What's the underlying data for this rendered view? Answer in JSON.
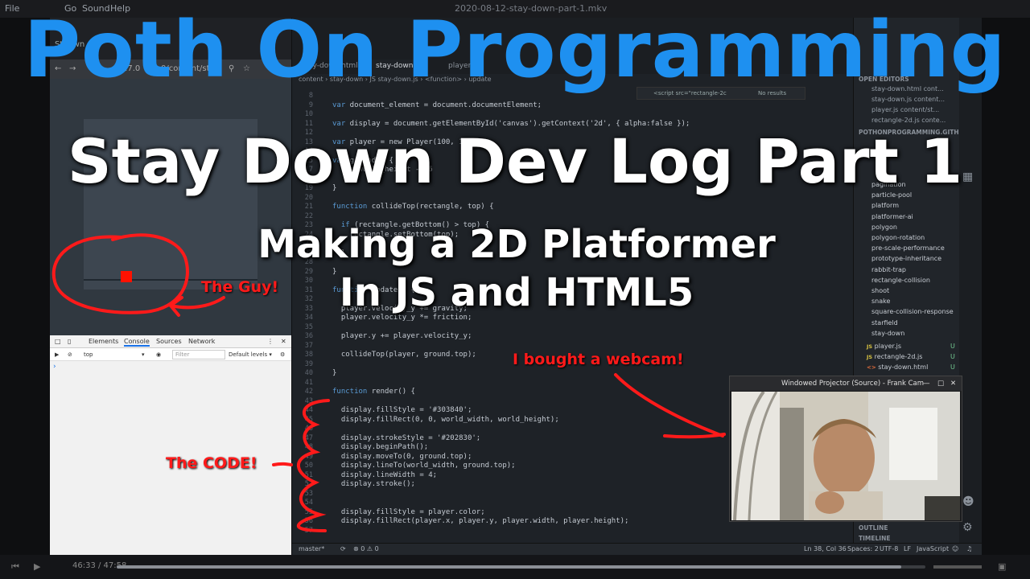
{
  "player": {
    "menu": [
      "File",
      "Go",
      "Sound",
      "Help"
    ],
    "video_title": "2020-08-12-stay-down-part-1.mkv",
    "time": "46:33 / 47:58",
    "progress": 0.97
  },
  "overlay": {
    "title": "Poth On Programming",
    "subtitle": "Stay Down Dev Log Part 1",
    "tagline_1": "Making a 2D Platformer",
    "tagline_2": "In JS and HTML5",
    "annotation_guy": "The Guy!",
    "annotation_code": "The CODE!",
    "annotation_cam": "I bought a webcam!"
  },
  "browser": {
    "tab": "St..own",
    "url_fragment": "27.0",
    "url_path": "0/content/sta...",
    "colors": {
      "world": "#303840",
      "ground": "#202830",
      "player": "#ff1100"
    }
  },
  "devtools": {
    "tabs": [
      "Elements",
      "Console",
      "Sources",
      "Network"
    ],
    "active_tab": "Console",
    "context": "top",
    "filter_placeholder": "Filter",
    "levels": "Default levels ▾"
  },
  "editor": {
    "tabs": [
      "...tay-down.html",
      "stay-down.js",
      "player.js"
    ],
    "breadcrumb": "content › stay-down › JS stay-down.js › <function> › update",
    "find_value": "<script src=\"rectangle-2c",
    "find_result": "No results",
    "lines": [
      {
        "n": "8",
        "t": ""
      },
      {
        "n": "9",
        "t": "var document_element = document.documentElement;"
      },
      {
        "n": "10",
        "t": ""
      },
      {
        "n": "11",
        "t": "var display = document.getElementById('canvas').getContext('2d', { alpha:false });"
      },
      {
        "n": "12",
        "t": ""
      },
      {
        "n": "13",
        "t": "var player = new Player(100, 100);"
      },
      {
        "n": "14",
        "t": ""
      },
      {
        "n": "15",
        "t": "var ground = {"
      },
      {
        "n": "17",
        "t": "  top:world_height - 16"
      },
      {
        "n": "18",
        "t": ""
      },
      {
        "n": "19",
        "t": "}"
      },
      {
        "n": "20",
        "t": ""
      },
      {
        "n": "21",
        "t": "function collideTop(rectangle, top) {"
      },
      {
        "n": "22",
        "t": ""
      },
      {
        "n": "23",
        "t": "  if (rectangle.getBottom() > top) {"
      },
      {
        "n": "24",
        "t": "    rectangle.setBottom(top);"
      },
      {
        "n": "25",
        "t": ""
      },
      {
        "n": "27",
        "t": "  }"
      },
      {
        "n": "28",
        "t": ""
      },
      {
        "n": "29",
        "t": "}"
      },
      {
        "n": "30",
        "t": ""
      },
      {
        "n": "31",
        "t": "function update() {"
      },
      {
        "n": "32",
        "t": ""
      },
      {
        "n": "33",
        "t": "  player.velocity_y += gravity;"
      },
      {
        "n": "34",
        "t": "  player.velocity_y *= friction;"
      },
      {
        "n": "35",
        "t": ""
      },
      {
        "n": "36",
        "t": "  player.y += player.velocity_y;"
      },
      {
        "n": "37",
        "t": ""
      },
      {
        "n": "38",
        "t": "  collideTop(player, ground.top);"
      },
      {
        "n": "39",
        "t": ""
      },
      {
        "n": "40",
        "t": "}"
      },
      {
        "n": "41",
        "t": ""
      },
      {
        "n": "42",
        "t": "function render() {"
      },
      {
        "n": "43",
        "t": ""
      },
      {
        "n": "44",
        "t": "  display.fillStyle = '#303840';"
      },
      {
        "n": "45",
        "t": "  display.fillRect(0, 0, world_width, world_height);"
      },
      {
        "n": "46",
        "t": ""
      },
      {
        "n": "47",
        "t": "  display.strokeStyle = '#202830';"
      },
      {
        "n": "48",
        "t": "  display.beginPath();"
      },
      {
        "n": "49",
        "t": "  display.moveTo(0, ground.top);"
      },
      {
        "n": "50",
        "t": "  display.lineTo(world_width, ground.top);"
      },
      {
        "n": "51",
        "t": "  display.lineWidth = 4;"
      },
      {
        "n": "52",
        "t": "  display.stroke();"
      },
      {
        "n": "53",
        "t": ""
      },
      {
        "n": "54",
        "t": ""
      },
      {
        "n": "55",
        "t": "  display.fillStyle = player.color;"
      },
      {
        "n": "56",
        "t": "  display.fillRect(player.x, player.y, player.width, player.height);"
      },
      {
        "n": "57",
        "t": ""
      }
    ]
  },
  "statusbar": {
    "branch": "master*",
    "problems": "⊗ 0 ⚠ 0",
    "cursor": "Ln 38, Col 36",
    "spaces": "Spaces: 2",
    "encoding": "UTF-8",
    "eol": "LF",
    "language": "JavaScript"
  },
  "sidebar": {
    "open_editors": "OPEN EDITORS",
    "open_files": [
      "stay-down.html  cont...",
      "stay-down.js  content...",
      "player.js  content/st...",
      "rectangle-2d.js  conte..."
    ],
    "repo": "POTHONPROGRAMMING.GITHUB.IO",
    "folders": [
      "pagination",
      "particle-pool",
      "platform",
      "platformer-ai",
      "polygon",
      "polygon-rotation",
      "pre-scale-performance",
      "prototype-inheritance",
      "rabbit-trap",
      "rectangle-collision",
      "shoot",
      "snake",
      "square-collision-response",
      "starfield",
      "stay-down"
    ],
    "files": [
      {
        "type": "JS",
        "name": "player.js",
        "status": "U"
      },
      {
        "type": "JS",
        "name": "rectangle-2d.js",
        "status": "U"
      },
      {
        "type": "<>",
        "name": "stay-down.html",
        "status": "U"
      }
    ],
    "outline": "OUTLINE",
    "timeline": "TIMELINE"
  },
  "projector": {
    "title": "Windowed Projector (Source) - Frank Cam",
    "controls": [
      "—",
      "□",
      "✕"
    ]
  },
  "colors": {
    "brand_blue": "#1e90f0",
    "annotation_red": "#ff1a1a"
  }
}
